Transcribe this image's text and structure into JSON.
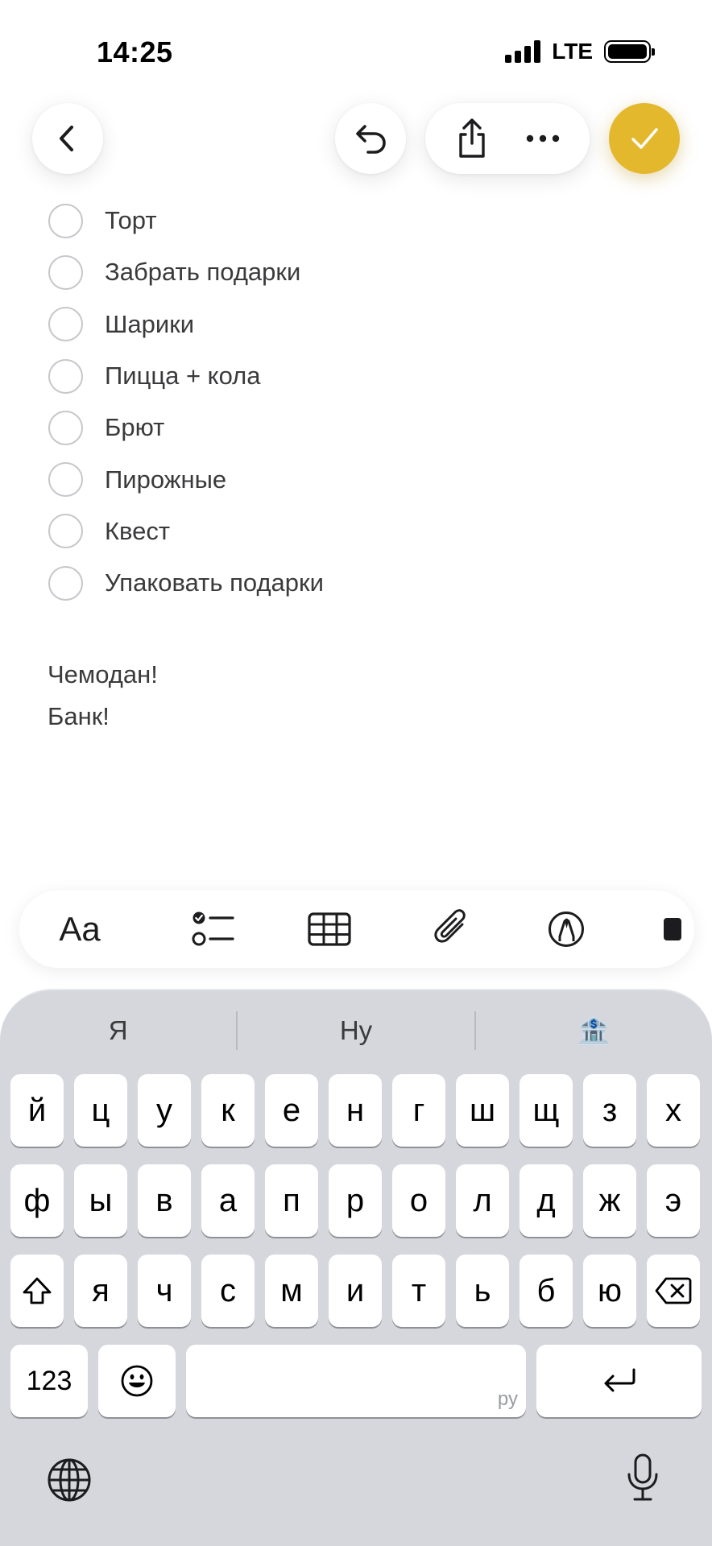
{
  "status_bar": {
    "time": "14:25",
    "network": "LTE"
  },
  "toolbar": {
    "back_icon": "chevron-left-icon",
    "undo_icon": "undo-icon",
    "share_icon": "share-icon",
    "more_icon": "ellipsis-icon",
    "done_icon": "checkmark-icon",
    "done_color": "#e4b82c"
  },
  "checklist": [
    {
      "label": "Торт",
      "checked": false
    },
    {
      "label": "Забрать подарки",
      "checked": false
    },
    {
      "label": "Шарики",
      "checked": false
    },
    {
      "label": "Пицца + кола",
      "checked": false
    },
    {
      "label": "Брют",
      "checked": false
    },
    {
      "label": "Пирожные",
      "checked": false
    },
    {
      "label": "Квест",
      "checked": false
    },
    {
      "label": "Упаковать подарки",
      "checked": false
    }
  ],
  "note_lines": [
    "Чемодан!",
    "Банк!"
  ],
  "format_bar": {
    "text_style_label": "Aa",
    "items": [
      "text-style-icon",
      "checklist-icon",
      "table-icon",
      "attachment-icon",
      "markup-icon"
    ]
  },
  "keyboard": {
    "suggestions": [
      "Я",
      "Ну",
      "🏦"
    ],
    "row1": [
      "й",
      "ц",
      "у",
      "к",
      "е",
      "н",
      "г",
      "ш",
      "щ",
      "з",
      "х"
    ],
    "row2": [
      "ф",
      "ы",
      "в",
      "а",
      "п",
      "р",
      "о",
      "л",
      "д",
      "ж",
      "э"
    ],
    "row3": [
      "я",
      "ч",
      "с",
      "м",
      "и",
      "т",
      "ь",
      "б",
      "ю"
    ],
    "numbers_label": "123",
    "space_hint": "ру",
    "emoji_icon": "emoji-icon",
    "return_icon": "return-icon",
    "globe_icon": "globe-icon",
    "mic_icon": "microphone-icon"
  }
}
